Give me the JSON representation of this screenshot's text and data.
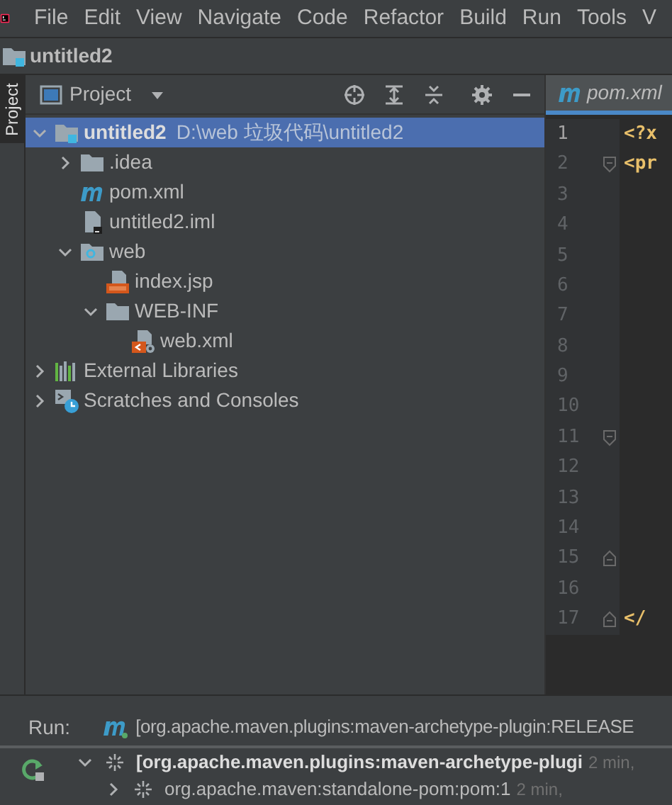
{
  "menu_bar": [
    "File",
    "Edit",
    "View",
    "Navigate",
    "Code",
    "Refactor",
    "Build",
    "Run",
    "Tools",
    "V"
  ],
  "project_title": "untitled2",
  "side_tabs": [
    {
      "label": "Project",
      "selected": true
    }
  ],
  "project_panel": {
    "title": "Project",
    "tree": [
      {
        "label": "untitled2",
        "path": "D:\\web 垃圾代码\\untitled2",
        "kind": "module",
        "expanded": true,
        "selected": true,
        "children": [
          {
            "label": ".idea",
            "kind": "folder",
            "expanded": false,
            "selected": false
          },
          {
            "label": "pom.xml",
            "kind": "maven",
            "selected": false
          },
          {
            "label": "untitled2.iml",
            "kind": "iml",
            "selected": false
          },
          {
            "label": "web",
            "kind": "webfolder",
            "expanded": true,
            "selected": false,
            "children": [
              {
                "label": "index.jsp",
                "kind": "jsp",
                "selected": false
              },
              {
                "label": "WEB-INF",
                "kind": "folder",
                "expanded": true,
                "selected": false,
                "children": [
                  {
                    "label": "web.xml",
                    "kind": "xml",
                    "selected": false
                  }
                ]
              }
            ]
          }
        ]
      },
      {
        "label": "External Libraries",
        "kind": "libraries",
        "expanded": false,
        "selected": false
      },
      {
        "label": "Scratches and Consoles",
        "kind": "scratches",
        "expanded": false,
        "selected": false
      }
    ]
  },
  "editor": {
    "tab": "pom.xml",
    "lines": [
      {
        "number": "1",
        "code": "<?x",
        "kind": "plain",
        "current": true
      },
      {
        "number": "2",
        "code": "<pr",
        "kind": "fold-start",
        "current": false
      },
      {
        "number": "3",
        "kind": "plain",
        "current": false
      },
      {
        "number": "4",
        "kind": "plain",
        "current": false
      },
      {
        "number": "5",
        "kind": "plain",
        "current": false
      },
      {
        "number": "6",
        "kind": "plain",
        "current": false
      },
      {
        "number": "7",
        "kind": "plain",
        "current": false
      },
      {
        "number": "8",
        "kind": "plain",
        "current": false
      },
      {
        "number": "9",
        "kind": "plain",
        "current": false
      },
      {
        "number": "10",
        "kind": "plain",
        "current": false
      },
      {
        "number": "11",
        "kind": "fold-start",
        "current": false
      },
      {
        "number": "12",
        "kind": "plain",
        "current": false
      },
      {
        "number": "13",
        "kind": "plain",
        "current": false
      },
      {
        "number": "14",
        "kind": "plain",
        "current": false
      },
      {
        "number": "15",
        "kind": "fold-end",
        "current": false
      },
      {
        "number": "16",
        "kind": "plain",
        "current": false
      },
      {
        "number": "17",
        "code": "</",
        "kind": "fold-end",
        "current": false
      }
    ]
  },
  "run_panel": {
    "label": "Run:",
    "tab": "[org.apache.maven.plugins:maven-archetype-plugin:RELEASE",
    "rows": [
      {
        "label": "[org.apache.maven.plugins:maven-archetype-plugi",
        "time": "2 min,",
        "expanded": true,
        "bold": true
      },
      {
        "label": "org.apache.maven:standalone-pom:pom:1",
        "time": "2 min,",
        "expanded": false,
        "bold": false
      }
    ]
  }
}
